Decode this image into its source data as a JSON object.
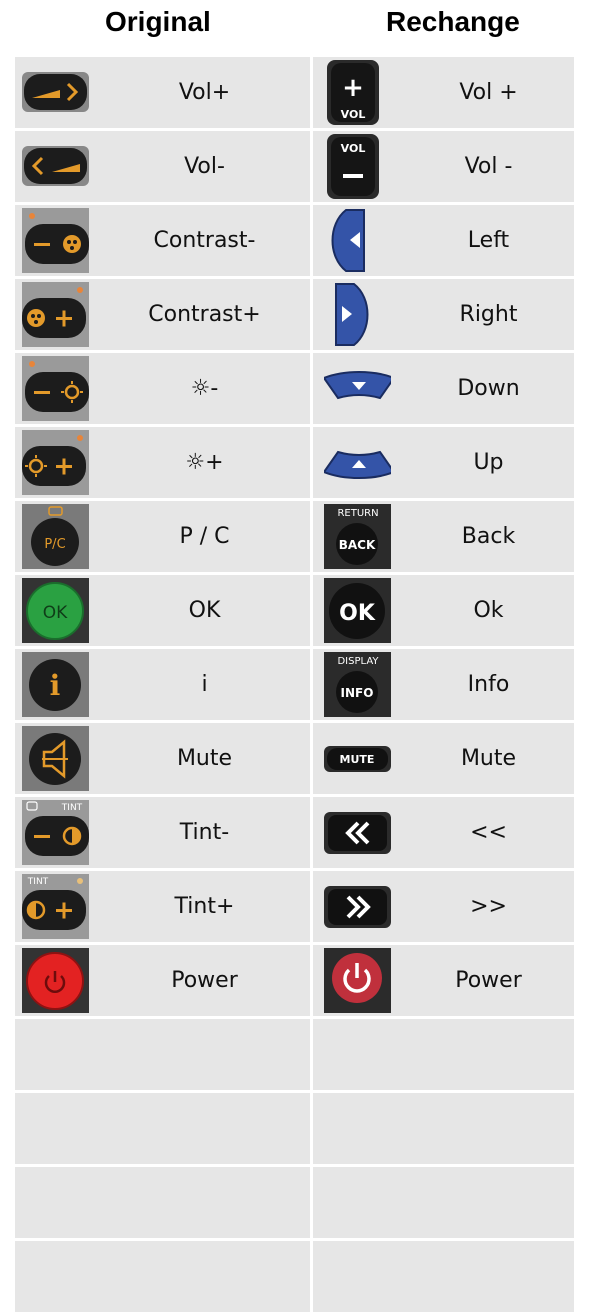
{
  "headers": {
    "original": "Original",
    "rechange": "Rechange"
  },
  "rows": [
    {
      "original": {
        "label": "Vol+",
        "icon": "vol-up-icon"
      },
      "rechange": {
        "label": "Vol +",
        "icon": "vol-plus-icon",
        "icon_text": "VOL"
      }
    },
    {
      "original": {
        "label": "Vol-",
        "icon": "vol-down-icon"
      },
      "rechange": {
        "label": "Vol -",
        "icon": "vol-minus-icon",
        "icon_text": "VOL"
      }
    },
    {
      "original": {
        "label": "Contrast-",
        "icon": "contrast-minus-icon"
      },
      "rechange": {
        "label": "Left",
        "icon": "left-arrow-icon"
      }
    },
    {
      "original": {
        "label": "Contrast+",
        "icon": "contrast-plus-icon"
      },
      "rechange": {
        "label": "Right",
        "icon": "right-arrow-icon"
      }
    },
    {
      "original": {
        "label": "☼-",
        "icon": "brightness-minus-icon"
      },
      "rechange": {
        "label": "Down",
        "icon": "down-arrow-icon"
      }
    },
    {
      "original": {
        "label": "☼+",
        "icon": "brightness-plus-icon"
      },
      "rechange": {
        "label": "Up",
        "icon": "up-arrow-icon"
      }
    },
    {
      "original": {
        "label": "P / C",
        "icon": "pc-button-icon",
        "icon_text": "P/C"
      },
      "rechange": {
        "label": "Back",
        "icon": "back-button-icon",
        "icon_text": "BACK",
        "icon_caption": "RETURN"
      }
    },
    {
      "original": {
        "label": "OK",
        "icon": "ok-green-button-icon",
        "icon_text": "OK"
      },
      "rechange": {
        "label": "Ok",
        "icon": "ok-black-button-icon",
        "icon_text": "OK"
      }
    },
    {
      "original": {
        "label": "i",
        "icon": "info-i-button-icon",
        "icon_text": "i"
      },
      "rechange": {
        "label": "Info",
        "icon": "info-button-icon",
        "icon_text": "INFO",
        "icon_caption": "DISPLAY"
      }
    },
    {
      "original": {
        "label": "Mute",
        "icon": "mute-speaker-icon"
      },
      "rechange": {
        "label": "Mute",
        "icon": "mute-button-icon",
        "icon_text": "MUTE"
      }
    },
    {
      "original": {
        "label": "Tint-",
        "icon": "tint-minus-icon",
        "icon_text": "TINT"
      },
      "rechange": {
        "label": "<<",
        "icon": "rewind-icon"
      }
    },
    {
      "original": {
        "label": "Tint+",
        "icon": "tint-plus-icon",
        "icon_text": "TINT"
      },
      "rechange": {
        "label": ">>",
        "icon": "fast-forward-icon"
      }
    },
    {
      "original": {
        "label": "Power",
        "icon": "power-red-icon"
      },
      "rechange": {
        "label": "Power",
        "icon": "power-button-icon"
      }
    },
    {
      "original": {
        "label": ""
      },
      "rechange": {
        "label": ""
      }
    },
    {
      "original": {
        "label": ""
      },
      "rechange": {
        "label": ""
      }
    },
    {
      "original": {
        "label": ""
      },
      "rechange": {
        "label": ""
      }
    },
    {
      "original": {
        "label": ""
      },
      "rechange": {
        "label": ""
      }
    }
  ],
  "colors": {
    "cell_bg": "#e6e6e6",
    "button_dark": "#1c1c1c",
    "accent_orange": "#e39a2a",
    "blue_button": "#3454a8",
    "green_button": "#2aa142",
    "red_button": "#e32222",
    "power_red": "#c0303c"
  }
}
